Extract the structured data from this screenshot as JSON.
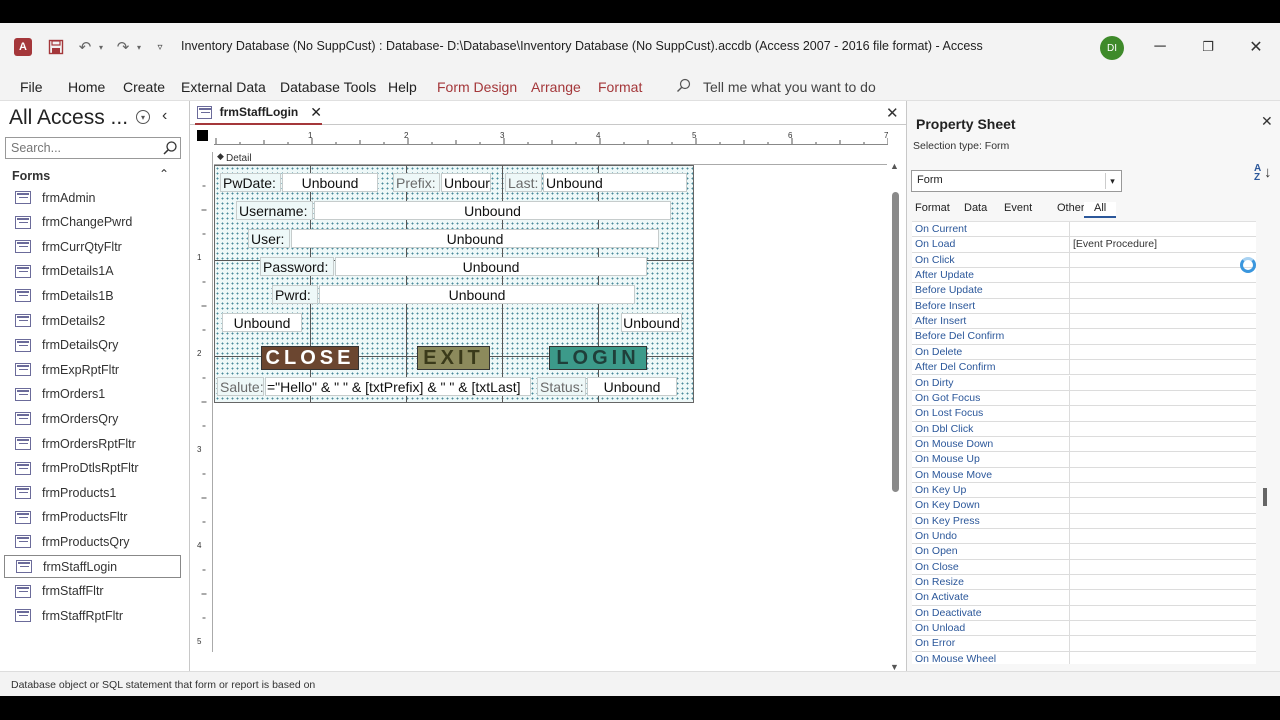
{
  "window": {
    "title": "Inventory Database (No SuppCust) : Database- D:\\Database\\Inventory Database (No SuppCust).accdb (Access 2007 - 2016 file format)  -  Access",
    "avatar": "DI",
    "app_icon_letter": "A"
  },
  "ribbon": {
    "tabs": [
      "File",
      "Home",
      "Create",
      "External Data",
      "Database Tools",
      "Help"
    ],
    "context_tabs": [
      "Form Design",
      "Arrange",
      "Format"
    ],
    "tell_me": "Tell me what you want to do"
  },
  "nav": {
    "title": "All Access ...",
    "search_placeholder": "Search...",
    "group": "Forms",
    "items": [
      "frmAdmin",
      "frmChangePwrd",
      "frmCurrQtyFltr",
      "frmDetails1A",
      "frmDetails1B",
      "frmDetails2",
      "frmDetailsQry",
      "frmExpRptFltr",
      "frmOrders1",
      "frmOrdersQry",
      "frmOrdersRptFltr",
      "frmProDtlsRptFltr",
      "frmProducts1",
      "frmProductsFltr",
      "frmProductsQry",
      "frmStaffLogin",
      "frmStaffFltr",
      "frmStaffRptFltr"
    ],
    "selected_index": 15
  },
  "doc": {
    "tab": "frmStaffLogin",
    "section": "Detail",
    "ruler_h": [
      "1",
      "2",
      "3",
      "4",
      "5",
      "6",
      "7"
    ],
    "ruler_v": [
      "1",
      "2",
      "3",
      "4",
      "5"
    ]
  },
  "form": {
    "pwdate_label": "PwDate:",
    "pwdate_value": "Unbound",
    "prefix_label": "Prefix:",
    "prefix_value": "Unbour",
    "last_label": "Last:",
    "last_value": "Unbound",
    "username_label": "Username:",
    "username_value": "Unbound",
    "user_label": "User:",
    "user_value": "Unbound",
    "password_label": "Password:",
    "password_value": "Unbound",
    "pwrd_label": "Pwrd:",
    "pwrd_value": "Unbound",
    "left_unbound": "Unbound",
    "right_unbound": "Unbound",
    "close_button": "CLOSE",
    "exit_button": "EXIT",
    "login_button": "LOGIN",
    "salute_label": "Salute:",
    "salute_value": "=\"Hello\" & \" \" & [txtPrefix] & \" \" & [txtLast]",
    "status_label": "Status:",
    "status_value": "Unbound"
  },
  "propsheet": {
    "title": "Property Sheet",
    "selection_type": "Selection type:  Form",
    "combo": "Form",
    "tabs": [
      "Format",
      "Data",
      "Event",
      "Other",
      "All"
    ],
    "active_tab": "All",
    "rows": [
      {
        "name": "On Current",
        "value": ""
      },
      {
        "name": "On Load",
        "value": "[Event Procedure]"
      },
      {
        "name": "On Click",
        "value": ""
      },
      {
        "name": "After Update",
        "value": ""
      },
      {
        "name": "Before Update",
        "value": ""
      },
      {
        "name": "Before Insert",
        "value": ""
      },
      {
        "name": "After Insert",
        "value": ""
      },
      {
        "name": "Before Del Confirm",
        "value": ""
      },
      {
        "name": "On Delete",
        "value": ""
      },
      {
        "name": "After Del Confirm",
        "value": ""
      },
      {
        "name": "On Dirty",
        "value": ""
      },
      {
        "name": "On Got Focus",
        "value": ""
      },
      {
        "name": "On Lost Focus",
        "value": ""
      },
      {
        "name": "On Dbl Click",
        "value": ""
      },
      {
        "name": "On Mouse Down",
        "value": ""
      },
      {
        "name": "On Mouse Up",
        "value": ""
      },
      {
        "name": "On Mouse Move",
        "value": ""
      },
      {
        "name": "On Key Up",
        "value": ""
      },
      {
        "name": "On Key Down",
        "value": ""
      },
      {
        "name": "On Key Press",
        "value": ""
      },
      {
        "name": "On Undo",
        "value": ""
      },
      {
        "name": "On Open",
        "value": ""
      },
      {
        "name": "On Close",
        "value": ""
      },
      {
        "name": "On Resize",
        "value": ""
      },
      {
        "name": "On Activate",
        "value": ""
      },
      {
        "name": "On Deactivate",
        "value": ""
      },
      {
        "name": "On Unload",
        "value": ""
      },
      {
        "name": "On Error",
        "value": ""
      },
      {
        "name": "On Mouse Wheel",
        "value": ""
      }
    ]
  },
  "status": {
    "text": "Database object or SQL statement that form or report is based on"
  },
  "colors": {
    "accent": "#a4373a",
    "close_btn": "#6b4630",
    "exit_btn": "#8c8a5c",
    "login_btn": "#3c9a8a",
    "prop_name": "#2b579a"
  }
}
